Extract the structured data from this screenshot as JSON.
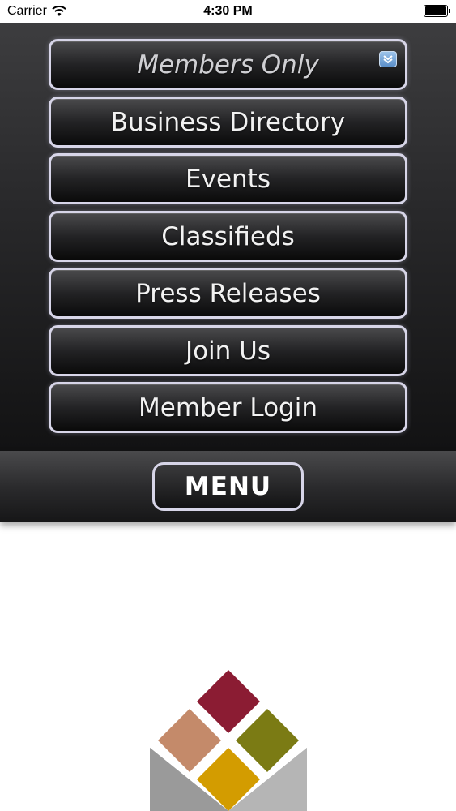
{
  "status_bar": {
    "carrier": "Carrier",
    "time": "4:30 PM",
    "battery_level": 1.0
  },
  "menu": {
    "header": {
      "label": "Members Only",
      "icon": "chevron-down-icon"
    },
    "items": [
      {
        "label": "Business Directory"
      },
      {
        "label": "Events"
      },
      {
        "label": "Classifieds"
      },
      {
        "label": "Press Releases"
      },
      {
        "label": "Join Us"
      },
      {
        "label": "Member Login"
      }
    ],
    "toggle_label": "MENU"
  },
  "colors": {
    "logo_top": "#8b1c33",
    "logo_left": "#c48a6a",
    "logo_right": "#7b7b14",
    "logo_bottom": "#d39c00",
    "logo_base": "#8e8e8e"
  }
}
